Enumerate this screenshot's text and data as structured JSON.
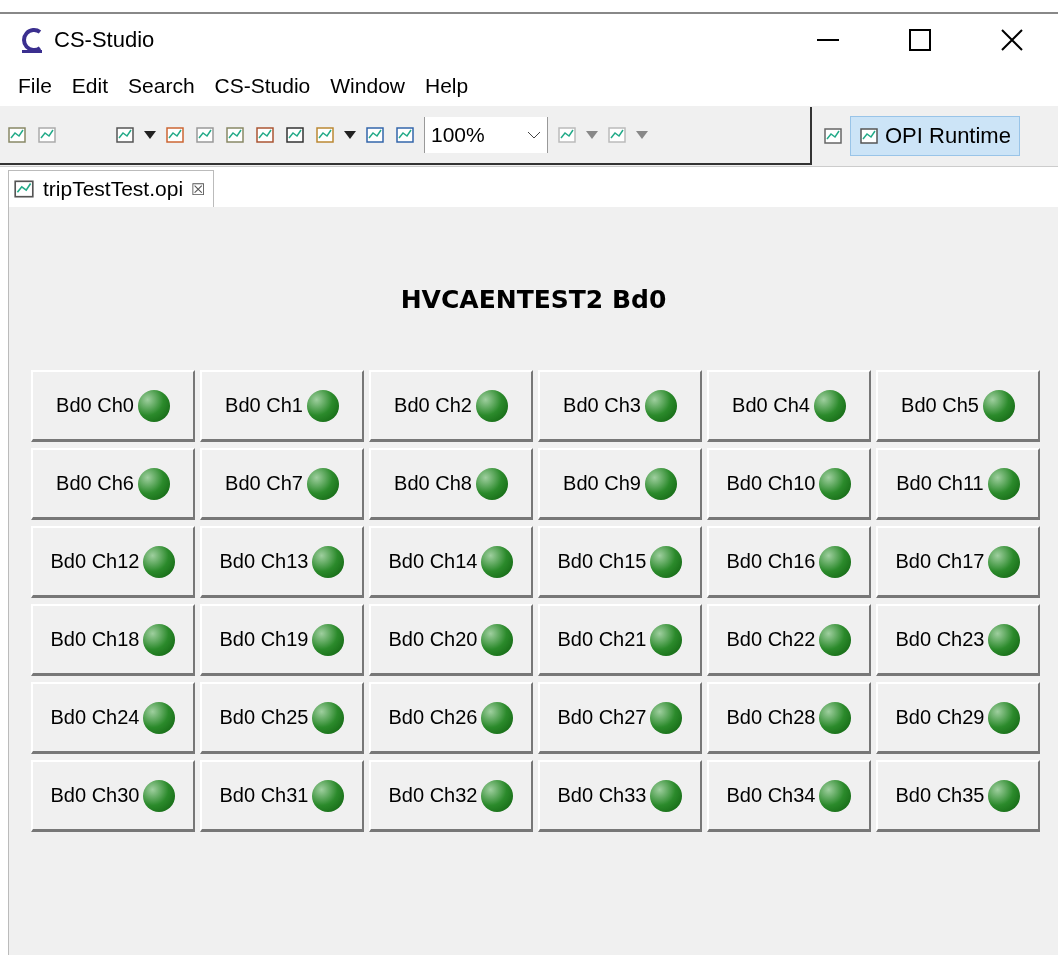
{
  "window": {
    "title": "CS-Studio"
  },
  "menu": [
    "File",
    "Edit",
    "Search",
    "CS-Studio",
    "Window",
    "Help"
  ],
  "toolbar": {
    "zoom": "100%",
    "perspective": {
      "label": "OPI Runtime",
      "selected": true
    }
  },
  "editor_tab": {
    "label": "tripTestTest.opi",
    "close": "☒"
  },
  "display": {
    "title": "HVCAENTEST2 Bd0",
    "channels": [
      {
        "label": "Bd0 Ch0",
        "on": true
      },
      {
        "label": "Bd0 Ch1",
        "on": true
      },
      {
        "label": "Bd0 Ch2",
        "on": true
      },
      {
        "label": "Bd0 Ch3",
        "on": true
      },
      {
        "label": "Bd0 Ch4",
        "on": true
      },
      {
        "label": "Bd0 Ch5",
        "on": true
      },
      {
        "label": "Bd0 Ch6",
        "on": true
      },
      {
        "label": "Bd0 Ch7",
        "on": true
      },
      {
        "label": "Bd0 Ch8",
        "on": true
      },
      {
        "label": "Bd0 Ch9",
        "on": true
      },
      {
        "label": "Bd0 Ch10",
        "on": true
      },
      {
        "label": "Bd0 Ch11",
        "on": true
      },
      {
        "label": "Bd0 Ch12",
        "on": true
      },
      {
        "label": "Bd0 Ch13",
        "on": true
      },
      {
        "label": "Bd0 Ch14",
        "on": true
      },
      {
        "label": "Bd0 Ch15",
        "on": true
      },
      {
        "label": "Bd0 Ch16",
        "on": true
      },
      {
        "label": "Bd0 Ch17",
        "on": true
      },
      {
        "label": "Bd0 Ch18",
        "on": true
      },
      {
        "label": "Bd0 Ch19",
        "on": true
      },
      {
        "label": "Bd0 Ch20",
        "on": true
      },
      {
        "label": "Bd0 Ch21",
        "on": true
      },
      {
        "label": "Bd0 Ch22",
        "on": true
      },
      {
        "label": "Bd0 Ch23",
        "on": true
      },
      {
        "label": "Bd0 Ch24",
        "on": true
      },
      {
        "label": "Bd0 Ch25",
        "on": true
      },
      {
        "label": "Bd0 Ch26",
        "on": true
      },
      {
        "label": "Bd0 Ch27",
        "on": true
      },
      {
        "label": "Bd0 Ch28",
        "on": true
      },
      {
        "label": "Bd0 Ch29",
        "on": true
      },
      {
        "label": "Bd0 Ch30",
        "on": true
      },
      {
        "label": "Bd0 Ch31",
        "on": true
      },
      {
        "label": "Bd0 Ch32",
        "on": true
      },
      {
        "label": "Bd0 Ch33",
        "on": true
      },
      {
        "label": "Bd0 Ch34",
        "on": true
      },
      {
        "label": "Bd0 Ch35",
        "on": true
      }
    ]
  }
}
